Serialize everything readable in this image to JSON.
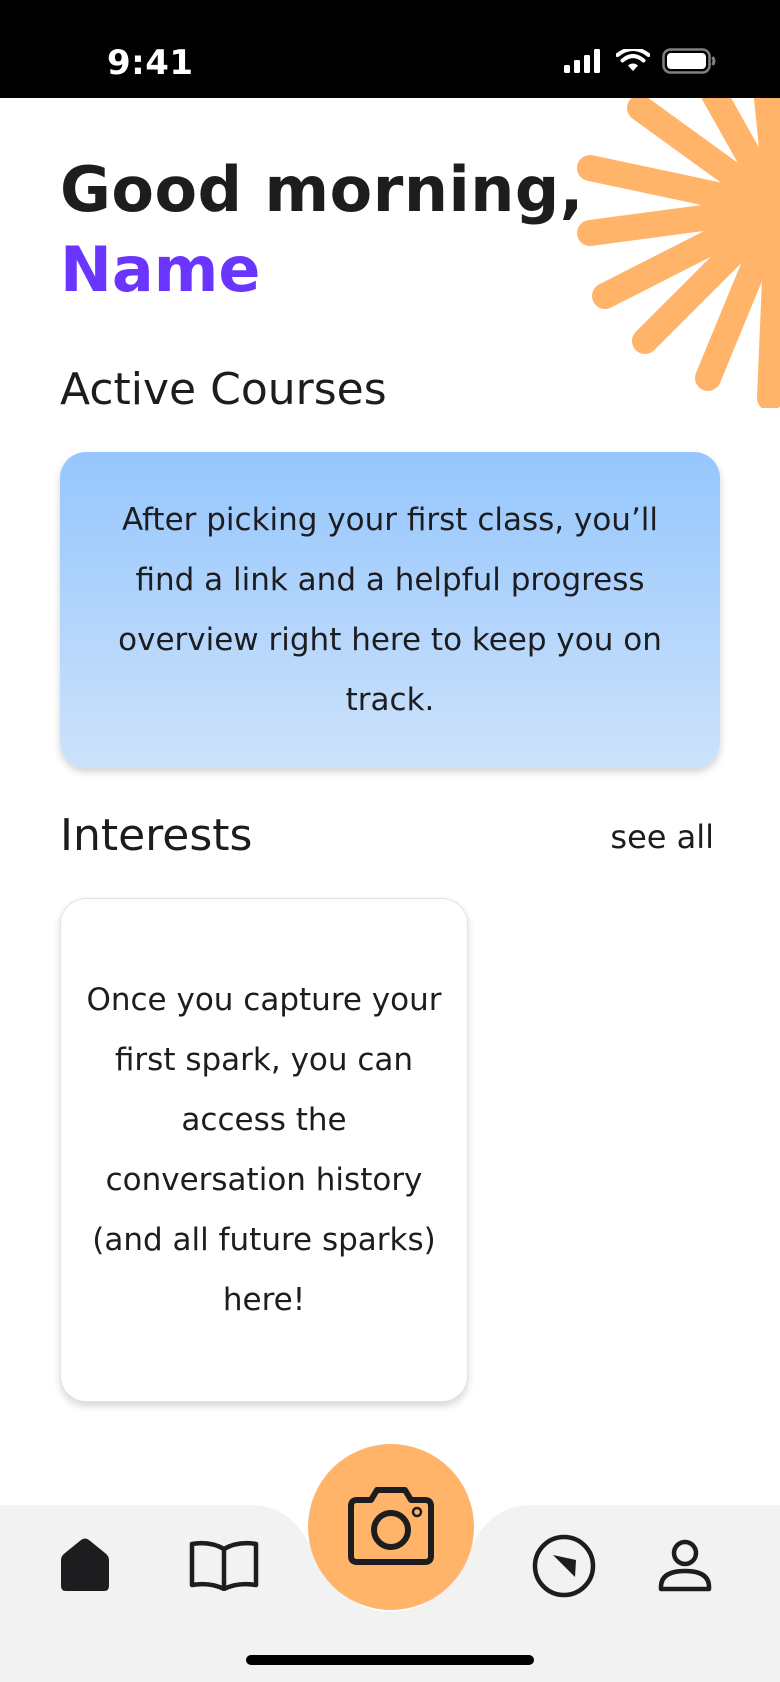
{
  "status_bar": {
    "time": "9:41",
    "icons": [
      "signal-icon",
      "wifi-icon",
      "battery-icon"
    ]
  },
  "greeting": {
    "line": "Good morning,",
    "name": "Name"
  },
  "active_courses": {
    "title": "Active Courses",
    "empty_message": "After picking your first class, you’ll find a link and a helpful progress overview right here to keep you on track."
  },
  "interests": {
    "title": "Interests",
    "see_all_label": "see all",
    "empty_message": "Once you capture your first spark, you can access the conversation history (and all future sparks) here!"
  },
  "tab_bar": {
    "items": [
      "home-icon",
      "book-icon",
      "camera-icon",
      "compass-icon",
      "profile-icon"
    ],
    "active": "home-icon"
  },
  "colors": {
    "accent_purple": "#6a35ff",
    "sunburst_orange": "#ffb46a",
    "card_gradient_top": "#95c6fd",
    "card_gradient_bottom": "#cde2fb",
    "tab_bar_bg": "#f2f2f2"
  }
}
